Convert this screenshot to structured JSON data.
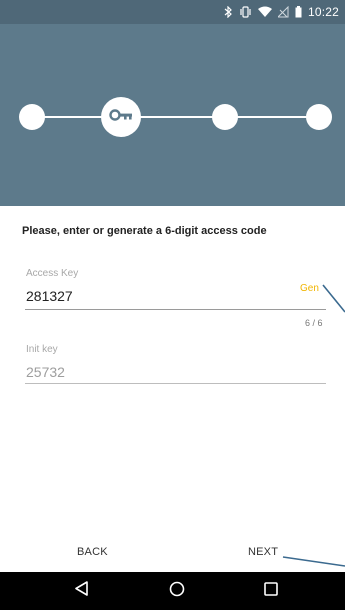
{
  "status_bar": {
    "time": "10:22",
    "icons": [
      "bluetooth-icon",
      "vibrate-icon",
      "wifi-icon",
      "no-signal-icon",
      "battery-icon"
    ]
  },
  "stepper": {
    "steps": 4,
    "current_step": 2,
    "current_icon": "key-icon"
  },
  "form": {
    "instruction": "Please, enter or generate a 6-digit access code",
    "access_key": {
      "label": "Access Key",
      "value": "281327",
      "gen_label": "Gen",
      "counter": "6 / 6"
    },
    "init_key": {
      "label": "Init key",
      "value": "25732"
    }
  },
  "actions": {
    "back_label": "BACK",
    "next_label": "NEXT"
  },
  "colors": {
    "header": "#5d7a8b",
    "status_bar": "#4f6878",
    "accent": "#f0b400",
    "pointer": "#3b6a8f"
  }
}
